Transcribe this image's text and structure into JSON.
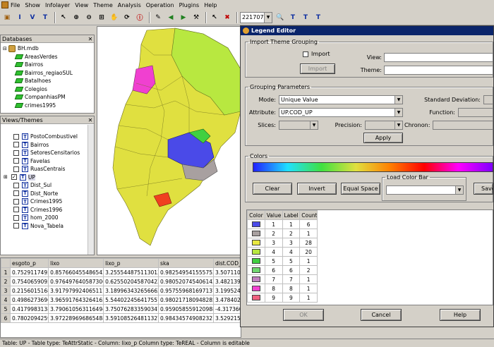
{
  "menu": {
    "items": [
      "File",
      "Show",
      "Infolayer",
      "View",
      "Theme",
      "Analysis",
      "Operation",
      "Plugins",
      "Help"
    ],
    "scale_value": "221707"
  },
  "databases_panel": {
    "title": "Databases",
    "root": "BH.mdb",
    "items": [
      "AreasVerdes",
      "Bairros",
      "Bairros_regiaoSUL",
      "Batalhoes",
      "Colegios",
      "CompanhiasPM",
      "crimes1995"
    ]
  },
  "views_panel": {
    "title": "Views/Themes",
    "items": [
      {
        "label": "PostoCombustivel",
        "checked": false
      },
      {
        "label": "Bairros",
        "checked": false
      },
      {
        "label": "SetoresCensitarios",
        "checked": false
      },
      {
        "label": "Favelas",
        "checked": false
      },
      {
        "label": "RuasCentrais",
        "checked": false
      },
      {
        "label": "UP",
        "checked": true
      },
      {
        "label": "Dist_Sul",
        "checked": false
      },
      {
        "label": "Dist_Norte",
        "checked": false
      },
      {
        "label": "Crimes1995",
        "checked": false
      },
      {
        "label": "Crimes1996",
        "checked": false
      },
      {
        "label": "hom_2000",
        "checked": false
      },
      {
        "label": "Nova_Tabela",
        "checked": false
      }
    ]
  },
  "table": {
    "columns": [
      "esgoto_p",
      "lixo",
      "lixo_p",
      "ska",
      "dist.COD_"
    ],
    "rows": [
      [
        "1",
        "0.7529117493",
        "0.857660455486542",
        "3.255544875113013",
        "0.9825495415557535",
        "3.5071106640047"
      ],
      [
        "2",
        "0.7540659093",
        "0.976497640587306",
        "0.6255020458704224",
        "0.9805207454061425",
        "3.4821393137895"
      ],
      [
        "3",
        "0.2156015168",
        "3.917979924065117",
        "3.1899634326566621",
        "0.9575596816971370",
        "3.1995240479385"
      ],
      [
        "4",
        "0.4986273696",
        "3.9659176432641650",
        "5.5440224564175571",
        "0.9802171809482851",
        "3.4784029030760"
      ],
      [
        "5",
        "0.4179983138",
        "3.7906105631164945",
        "3.7507628335903470",
        "0.9590585591209889",
        "-4.3173607732590"
      ],
      [
        "6",
        "0.7802094259",
        "3.9722896968654889",
        "3.5910852648113270",
        "0.9843457490823210",
        "3.5292158838658"
      ]
    ]
  },
  "status_text": "Table: UP - Table type: TeAttrStatic - Column: lixo_p  Column type: TeREAL - Column is editable",
  "legend_editor": {
    "title": "Legend Editor",
    "import_group": {
      "legend": "Import Theme Grouping",
      "import_check_label": "Import",
      "import_button": "Import",
      "view_label": "View:",
      "theme_label": "Theme:"
    },
    "grouping": {
      "legend": "Grouping Parameters",
      "mode_label": "Mode:",
      "mode_value": "Unique Value",
      "attribute_label": "Attribute:",
      "attribute_value": "UP.COD_UP",
      "slices_label": "Slices:",
      "precision_label": "Precision:",
      "std_dev_label": "Standard Deviation:",
      "function_label": "Function:",
      "chronon_label": "Chronon:",
      "apply_button": "Apply"
    },
    "colors": {
      "legend": "Colors",
      "clear_button": "Clear",
      "invert_button": "Invert",
      "equal_space_button": "Equal Space",
      "load_color_bar_label": "Load Color Bar",
      "save_button": "Save"
    },
    "grid": {
      "headers": [
        "Color",
        "Value",
        "Label",
        "Count"
      ],
      "rows": [
        {
          "color": "#4a4ae8",
          "value": "1",
          "label": "1",
          "count": "6"
        },
        {
          "color": "#a8a0a0",
          "value": "2",
          "label": "2",
          "count": "1"
        },
        {
          "color": "#e8e840",
          "value": "3",
          "label": "3",
          "count": "28"
        },
        {
          "color": "#b8e840",
          "value": "4",
          "label": "4",
          "count": "20"
        },
        {
          "color": "#40d040",
          "value": "5",
          "label": "5",
          "count": "1"
        },
        {
          "color": "#70d870",
          "value": "6",
          "label": "6",
          "count": "2"
        },
        {
          "color": "#c080c0",
          "value": "7",
          "label": "7",
          "count": "1"
        },
        {
          "color": "#f040d0",
          "value": "8",
          "label": "8",
          "count": "1"
        },
        {
          "color": "#f06080",
          "value": "9",
          "label": "9",
          "count": "1"
        }
      ]
    },
    "ok_button": "OK",
    "cancel_button": "Cancel",
    "help_button": "Help"
  }
}
